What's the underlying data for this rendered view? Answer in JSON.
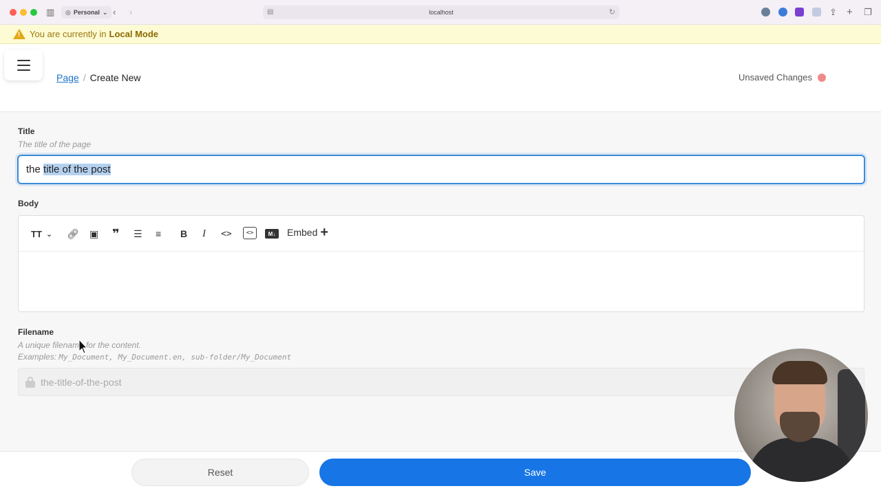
{
  "browser": {
    "profile_label": "Personal",
    "address": "localhost"
  },
  "banner": {
    "text": "You are currently in",
    "mode": "Local Mode"
  },
  "header": {
    "breadcrumb_root": "Page",
    "breadcrumb_separator": "/",
    "breadcrumb_current": "Create New",
    "status_label": "Unsaved Changes",
    "status_color": "#f08a8a"
  },
  "form": {
    "title_label": "Title",
    "title_hint": "The title of the page",
    "title_value_prefix": "the ",
    "title_value_selected": "title of the post",
    "body_label": "Body",
    "toolbar": {
      "text_style": "TT",
      "markdown": "M↓",
      "embed_label": "Embed"
    },
    "filename_label": "Filename",
    "filename_hint": "A unique filename for the content.",
    "filename_examples_prefix": "Examples:",
    "filename_examples": "My_Document, My_Document.en, sub-folder/My_Document",
    "filename_value": "the-title-of-the-post"
  },
  "actions": {
    "reset_label": "Reset",
    "save_label": "Save",
    "save_color": "#1775e6"
  }
}
